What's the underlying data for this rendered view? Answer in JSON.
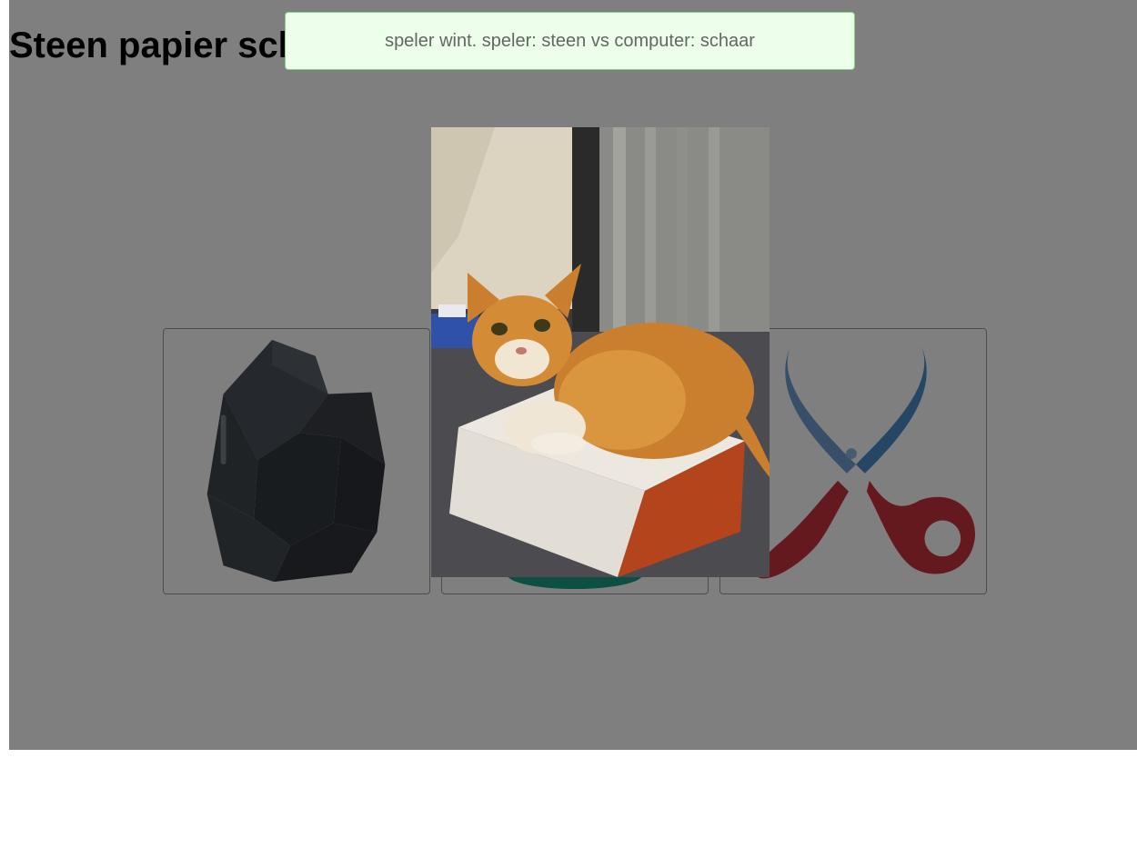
{
  "page": {
    "title": "Steen papier schaar"
  },
  "choices": [
    {
      "id": "steen",
      "icon": "rock-icon"
    },
    {
      "id": "papier",
      "icon": "paper-icon"
    },
    {
      "id": "schaar",
      "icon": "scissors-icon"
    }
  ],
  "result_message": "speler wint. speler: steen vs computer: schaar",
  "popup_image": {
    "icon": "cat-on-box-photo"
  },
  "colors": {
    "overlay": "#808080",
    "toast_background": "#edffea",
    "toast_border": "#7dd67d",
    "paper_accent": "#1a9f86",
    "scissors_red": "#c8323c",
    "scissors_blue": "#4a8fcb"
  }
}
